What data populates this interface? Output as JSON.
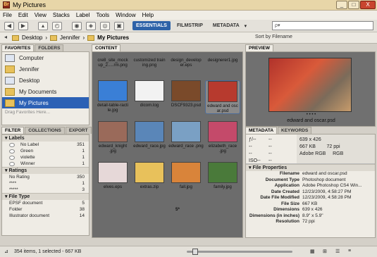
{
  "window": {
    "title": "My Pictures",
    "buttons": [
      "_",
      "□",
      "X"
    ]
  },
  "menu": [
    "File",
    "Edit",
    "View",
    "Stacks",
    "Label",
    "Tools",
    "Window",
    "Help"
  ],
  "workspaces": [
    "ESSENTIALS",
    "FILMSTRIP",
    "METADATA"
  ],
  "search": {
    "placeholder": "ρ▾"
  },
  "path": [
    "Desktop",
    "Jennifer",
    "My Pictures"
  ],
  "sort_label": "Sort by Filename",
  "favorites": {
    "tabs": [
      "FAVORITES",
      "FOLDERS"
    ],
    "items": [
      "Computer",
      "Jennifer",
      "Desktop",
      "My Documents",
      "My Pictures"
    ],
    "hint": "Drag Favorites Here..."
  },
  "filter": {
    "tabs": [
      "FILTER",
      "COLLECTIONS",
      "EXPORT"
    ],
    "labels_title": "Labels",
    "labels": [
      {
        "name": "No Label",
        "count": "351"
      },
      {
        "name": "Green",
        "count": "1"
      },
      {
        "name": "violette",
        "count": "1"
      },
      {
        "name": "Winner",
        "count": "1"
      }
    ],
    "ratings_title": "Ratings",
    "ratings": [
      {
        "name": "No Rating",
        "count": "350"
      },
      {
        "name": "****",
        "count": "1"
      },
      {
        "name": "*****",
        "count": "3"
      }
    ],
    "filetype_title": "File Type",
    "filetypes": [
      {
        "name": "EPSF document",
        "count": "5"
      },
      {
        "name": "Folder",
        "count": "38"
      },
      {
        "name": "Illustrator document",
        "count": "14"
      }
    ]
  },
  "content": {
    "tab": "CONTENT",
    "top_captions": [
      "cre8_site_mock up_2.....rm.png",
      "customized train ing.png",
      "design_develop er.eps",
      "designerer1.jpg"
    ],
    "thumbs": [
      {
        "cap": "detail-table-racti le.jpg",
        "color": "#3a7fd6"
      },
      {
        "cap": "dicom.log",
        "color": "#f2f2f2"
      },
      {
        "cap": "DSCF9323.psd",
        "color": "#7a4a2a"
      },
      {
        "cap": "edward and osc ar.psd",
        "color": "#b73a2e"
      },
      {
        "cap": "edward_knight .jpg",
        "color": "#9a6a5a"
      },
      {
        "cap": "edward_race.jpg",
        "color": "#5a86b8"
      },
      {
        "cap": "edward_race .png",
        "color": "#7aa0c4"
      },
      {
        "cap": "elizabeth_race .jpg",
        "color": "#c44a6a"
      },
      {
        "cap": "elves.eps",
        "color": "#e6d8d8"
      },
      {
        "cap": "extras.zip",
        "color": "#e8c15b"
      },
      {
        "cap": "fall.jpg",
        "color": "#d9843a"
      },
      {
        "cap": "family.jpg",
        "color": "#4a7a3a"
      }
    ],
    "rating_mark": "5*"
  },
  "preview": {
    "tab": "PREVIEW",
    "caption": "edward and oscar.psd",
    "dots": "• • • •"
  },
  "metadata": {
    "tabs": [
      "METADATA",
      "KEYWORDS"
    ],
    "top_left": [
      "ƒ/--",
      "--",
      "--",
      "ISO--"
    ],
    "top_mid": [
      "--",
      "--",
      "--",
      "--"
    ],
    "top_right": [
      "639 x 426",
      "667 KB",
      "Adobe RGB",
      "72 ppi",
      "RGB"
    ],
    "section": "File Properties",
    "rows": [
      {
        "k": "Filename",
        "v": "edward and oscar.psd"
      },
      {
        "k": "Document Type",
        "v": "Photoshop document"
      },
      {
        "k": "Application",
        "v": "Adobe Photoshop CS4 Win..."
      },
      {
        "k": "Date Created",
        "v": "12/23/2009, 4:58:27 PM"
      },
      {
        "k": "Date File Modified",
        "v": "12/23/2009, 4:58:28 PM"
      },
      {
        "k": "File Size",
        "v": "667 KB"
      },
      {
        "k": "Dimensions",
        "v": "639 x 426"
      },
      {
        "k": "Dimensions (in inches)",
        "v": "8.9\" x 5.9\""
      },
      {
        "k": "Resolution",
        "v": "72 ppi"
      }
    ]
  },
  "status": {
    "text": "354 items, 1 selected - 667 KB",
    "zoom_level": 0.05
  }
}
